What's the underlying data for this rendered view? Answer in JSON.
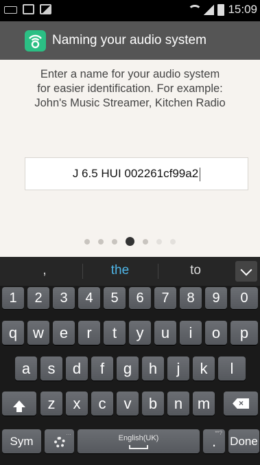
{
  "status_bar": {
    "time": "15:09",
    "icons": [
      "keyboard-icon",
      "data-icon",
      "image-icon",
      "wifi-icon",
      "signal-icon",
      "battery-icon"
    ]
  },
  "title_bar": {
    "icon": "audio-system-app-icon",
    "title": "Naming your audio system"
  },
  "main": {
    "instruction_lines": [
      "Enter a name for your audio system",
      "for easier identification. For example:",
      "John's Music Streamer, Kitchen Radio"
    ],
    "name_input": {
      "value": "J 6.5 HUI 002261cf99a2"
    },
    "pager": {
      "total": 7,
      "active_index": 3
    }
  },
  "keyboard": {
    "suggestions": [
      ",",
      "the",
      "to"
    ],
    "rows": {
      "numbers": [
        "1",
        "2",
        "3",
        "4",
        "5",
        "6",
        "7",
        "8",
        "9",
        "0"
      ],
      "row1": [
        "q",
        "w",
        "e",
        "r",
        "t",
        "y",
        "u",
        "i",
        "o",
        "p"
      ],
      "row2": [
        "a",
        "s",
        "d",
        "f",
        "g",
        "h",
        "j",
        "k",
        "l"
      ],
      "row3": [
        "z",
        "x",
        "c",
        "v",
        "b",
        "n",
        "m"
      ]
    },
    "sym_label": "Sym",
    "space_label": "English(UK)",
    "period_label": ".",
    "period_hint": "**?",
    "settings_hint": "…",
    "done_label": "Done"
  },
  "colors": {
    "accent": "#2bbf84",
    "title_bar": "#555555",
    "suggestion_highlight": "#4fb6e8"
  }
}
